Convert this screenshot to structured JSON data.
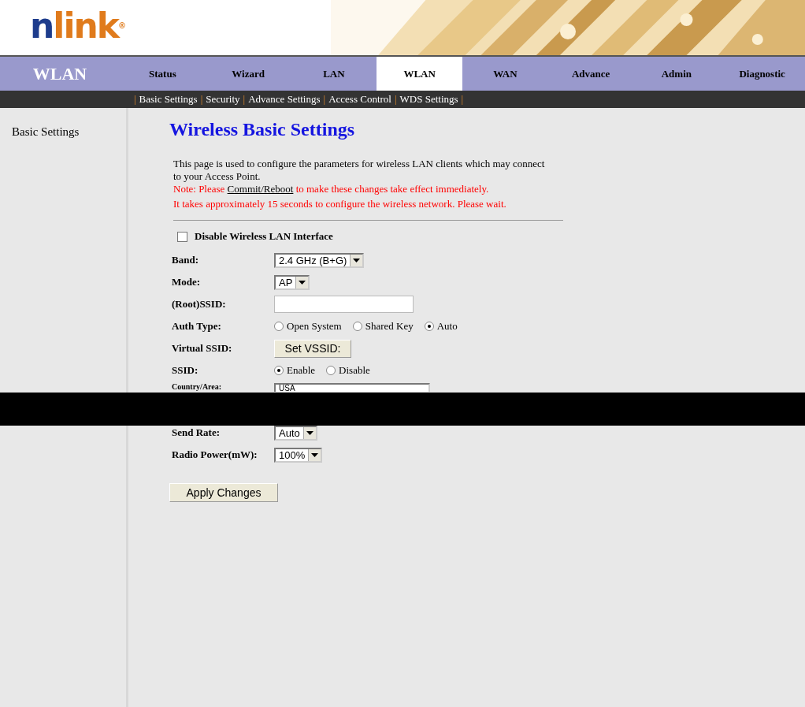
{
  "logo": {
    "first": "n",
    "rest": "link",
    "mark": "®"
  },
  "section_title": "WLAN",
  "tabs": [
    {
      "label": "Status",
      "selected": false
    },
    {
      "label": "Wizard",
      "selected": false
    },
    {
      "label": "LAN",
      "selected": false
    },
    {
      "label": "WLAN",
      "selected": true
    },
    {
      "label": "WAN",
      "selected": false
    },
    {
      "label": "Advance",
      "selected": false
    },
    {
      "label": "Admin",
      "selected": false
    },
    {
      "label": "Diagnostic",
      "selected": false
    }
  ],
  "subnav": {
    "separator": "|",
    "links": [
      "Basic Settings",
      "Security",
      "Advance Settings",
      "Access Control",
      "WDS Settings"
    ]
  },
  "sidebar": {
    "items": [
      "Basic Settings"
    ]
  },
  "page_title": "Wireless Basic Settings",
  "intro": "This page is used to configure the parameters for wireless LAN clients which may connect to your Access Point.",
  "note": {
    "before": "Note: Please ",
    "link": "Commit/Reboot",
    "after": " to make these changes take effect immediately."
  },
  "wait_text": "It takes approximately 15 seconds to configure the wireless network. Please wait.",
  "disable_wlan": {
    "label": "Disable Wireless LAN Interface",
    "checked": false
  },
  "fields": [
    {
      "kind": "select",
      "label": "Band:",
      "value": "2.4 GHz (B+G)"
    },
    {
      "kind": "select",
      "label": "Mode:",
      "value": "AP"
    },
    {
      "kind": "text",
      "label": "(Root)SSID:"
    },
    {
      "kind": "radio",
      "label": "Auth Type:",
      "options": [
        {
          "label": "Open System",
          "selected": false
        },
        {
          "label": "Shared Key",
          "selected": false
        },
        {
          "label": "Auto",
          "selected": true
        }
      ]
    },
    {
      "kind": "button",
      "label": "Virtual SSID:",
      "value": "Set VSSID:"
    },
    {
      "kind": "radio",
      "label": "SSID:",
      "options": [
        {
          "label": "Enable",
          "selected": true
        },
        {
          "label": "Disable",
          "selected": false
        }
      ]
    },
    {
      "kind": "cut",
      "label": "Country/Area:",
      "value": "USA"
    },
    {
      "kind": "select",
      "label": "Send Rate:",
      "value": "Auto"
    },
    {
      "kind": "select",
      "label": "Radio Power(mW):",
      "value": "100%"
    }
  ],
  "apply_button": "Apply Changes"
}
